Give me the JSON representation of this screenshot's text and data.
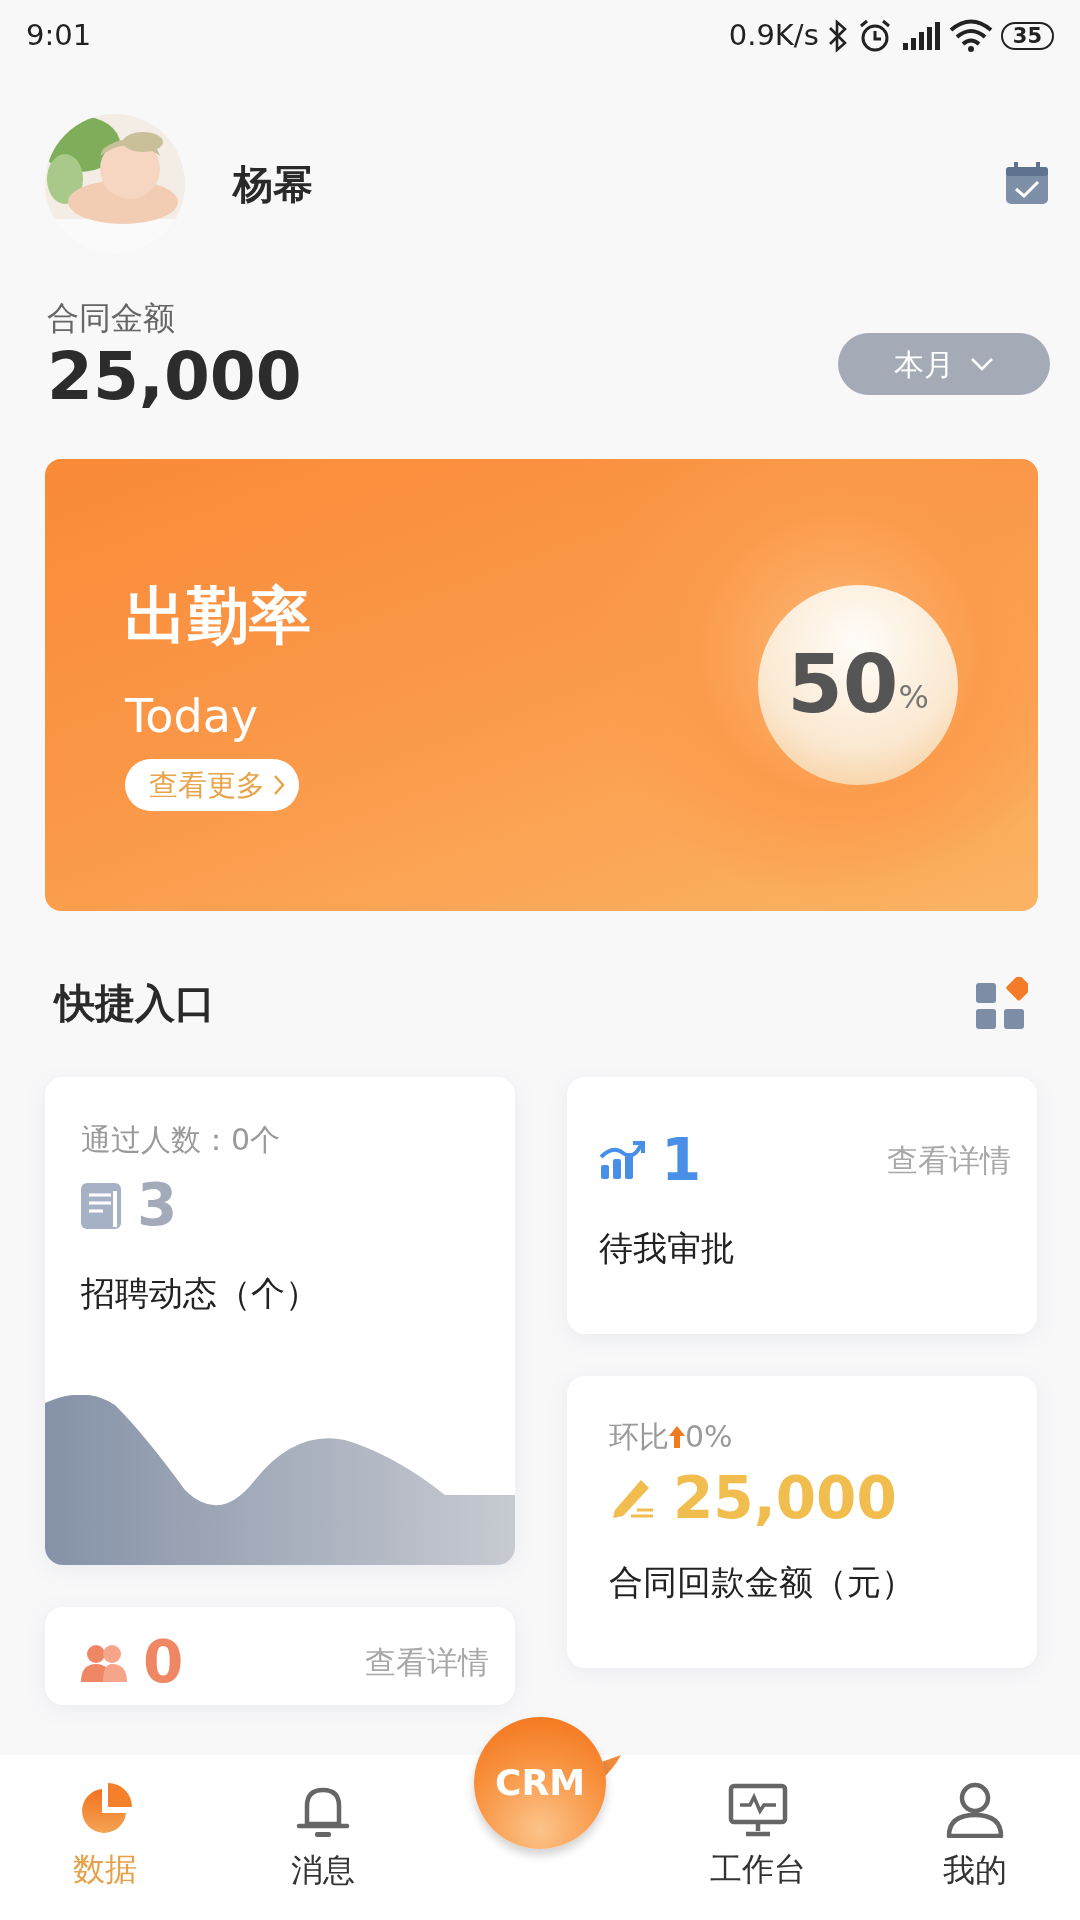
{
  "status_bar": {
    "time": "9:01",
    "net_speed": "0.9K/s",
    "battery": "35"
  },
  "header": {
    "user_name": "杨幂"
  },
  "summary": {
    "label": "合同金额",
    "value": "25,000",
    "period_button": "本月"
  },
  "attendance_banner": {
    "title": "出勤率",
    "subtitle": "Today",
    "more_button": "查看更多",
    "value": "50",
    "unit": "%"
  },
  "shortcuts": {
    "title": "快捷入口",
    "columns": [
      {
        "cards": [
          {
            "kind": "recruit",
            "note": "通过人数：0个",
            "value": "3",
            "label": "招聘动态（个）"
          },
          {
            "kind": "people",
            "value": "0",
            "link": "查看详情"
          }
        ]
      },
      {
        "cards": [
          {
            "kind": "approval",
            "value": "1",
            "link": "查看详情",
            "label": "待我审批"
          },
          {
            "kind": "payback",
            "note": "环比",
            "change": "0%",
            "value": "25,000",
            "label": "合同回款金额（元）"
          }
        ]
      }
    ]
  },
  "tab_bar": [
    {
      "kind": "data",
      "label": "数据",
      "selected": true
    },
    {
      "kind": "message",
      "label": "消息",
      "selected": false
    },
    {
      "kind": "center",
      "label": "CRM",
      "selected": false
    },
    {
      "kind": "workbench",
      "label": "工作台",
      "selected": false
    },
    {
      "kind": "mine",
      "label": "我的",
      "selected": false
    }
  ]
}
